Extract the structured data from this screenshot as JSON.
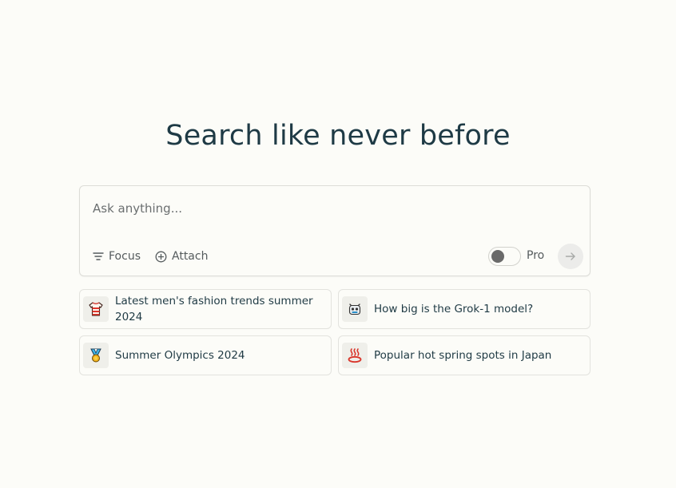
{
  "hero": {
    "title": "Search like never before"
  },
  "search": {
    "placeholder": "Ask anything...",
    "focus_label": "Focus",
    "attach_label": "Attach",
    "pro_label": "Pro",
    "pro_enabled": false
  },
  "suggestions": [
    {
      "label": "Latest men's fashion trends summer 2024",
      "icon": "shirt-icon"
    },
    {
      "label": "How big is the Grok-1 model?",
      "icon": "robot-icon"
    },
    {
      "label": "Summer Olympics 2024",
      "icon": "medal-icon"
    },
    {
      "label": "Popular hot spring spots in Japan",
      "icon": "hot-spring-icon"
    }
  ],
  "colors": {
    "background": "#fcfcf8",
    "title": "#1e3a45",
    "muted_text": "#555b5d",
    "border": "#dcdcd7"
  }
}
